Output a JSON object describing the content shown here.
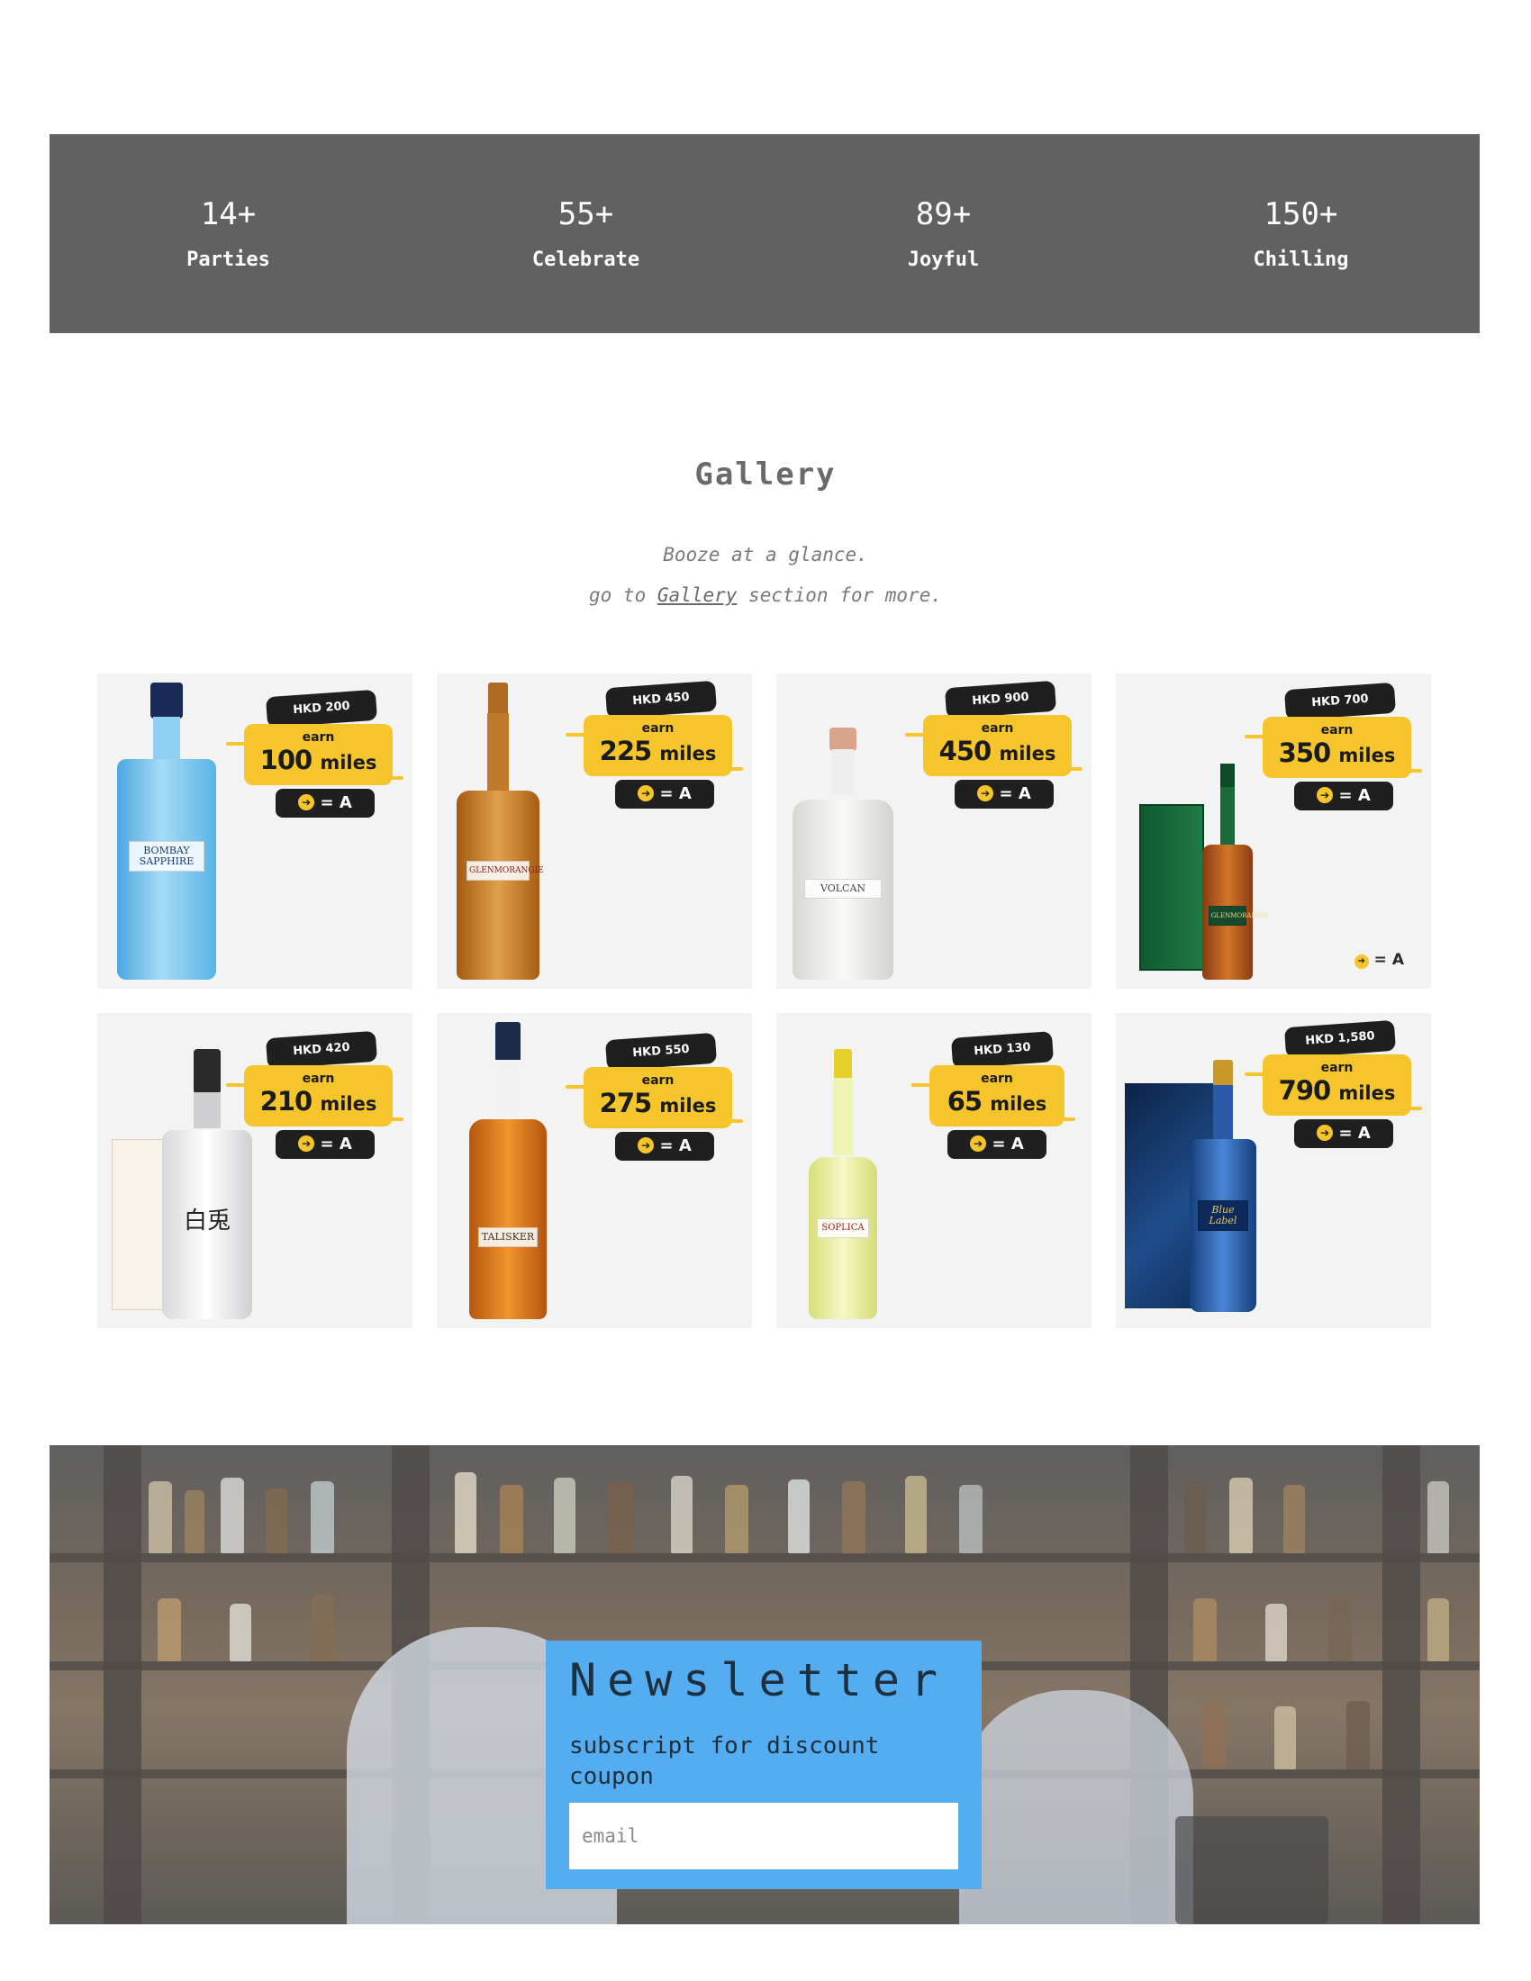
{
  "stats": [
    {
      "value": "14+",
      "label": "Parties"
    },
    {
      "value": "55+",
      "label": "Celebrate"
    },
    {
      "value": "89+",
      "label": "Joyful"
    },
    {
      "value": "150+",
      "label": "Chilling"
    }
  ],
  "gallery": {
    "title": "Gallery",
    "subtitle": "Booze at a glance.",
    "more_prefix": "go to",
    "more_link": "Gallery",
    "more_suffix": "section for more."
  },
  "products": [
    {
      "price": "HKD 200",
      "earn": "earn",
      "miles": "100",
      "unit": "miles",
      "bottle_label": "BOMBAY SAPPHIRE",
      "color": "#6cc0ee"
    },
    {
      "price": "HKD 450",
      "earn": "earn",
      "miles": "225",
      "unit": "miles",
      "bottle_label": "GLENMORANGIE",
      "color": "#c77a1e"
    },
    {
      "price": "HKD 900",
      "earn": "earn",
      "miles": "450",
      "unit": "miles",
      "bottle_label": "VOLCAN",
      "color": "#e8e8e6"
    },
    {
      "price": "HKD 700",
      "earn": "earn",
      "miles": "350",
      "unit": "miles",
      "bottle_label": "GLENMORANGIE",
      "color": "#b35a1a"
    },
    {
      "price": "HKD 420",
      "earn": "earn",
      "miles": "210",
      "unit": "miles",
      "bottle_label": "白兎",
      "color": "#f2f2f2"
    },
    {
      "price": "HKD 550",
      "earn": "earn",
      "miles": "275",
      "unit": "miles",
      "bottle_label": "TALISKER",
      "color": "#d9731c"
    },
    {
      "price": "HKD 130",
      "earn": "earn",
      "miles": "65",
      "unit": "miles",
      "bottle_label": "SOPLICA",
      "color": "#e7ec9a"
    },
    {
      "price": "HKD 1,580",
      "earn": "earn",
      "miles": "790",
      "unit": "miles",
      "bottle_label": "Blue Label",
      "color": "#1d4b8a"
    }
  ],
  "conversion": {
    "equals": "="
  },
  "newsletter": {
    "title": "Newsletter",
    "subtitle": "subscript for discount coupon",
    "email_placeholder": "email"
  },
  "colors": {
    "stats_bg": "#616161",
    "badge_yellow": "#f5c52b",
    "newsletter_bg": "#55adf1"
  }
}
